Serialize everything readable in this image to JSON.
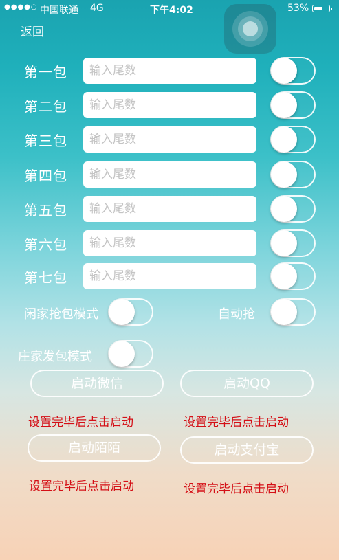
{
  "status_bar": {
    "signal": "●●●●○",
    "carrier": "中国联通",
    "network": "4G",
    "time": "下午4:02",
    "battery_percent": "53%"
  },
  "nav": {
    "back_label": "返回"
  },
  "packages": [
    {
      "label": "第一包",
      "placeholder": "输入尾数",
      "value": "",
      "enabled": false
    },
    {
      "label": "第二包",
      "placeholder": "输入尾数",
      "value": "",
      "enabled": false
    },
    {
      "label": "第三包",
      "placeholder": "输入尾数",
      "value": "",
      "enabled": false
    },
    {
      "label": "第四包",
      "placeholder": "输入尾数",
      "value": "",
      "enabled": false
    },
    {
      "label": "第五包",
      "placeholder": "输入尾数",
      "value": "",
      "enabled": false
    },
    {
      "label": "第六包",
      "placeholder": "输入尾数",
      "value": "",
      "enabled": false
    },
    {
      "label": "第七包",
      "placeholder": "输入尾数",
      "value": "",
      "enabled": false
    }
  ],
  "modes": {
    "idle_grab_label": "闲家抢包模式",
    "idle_grab_enabled": false,
    "auto_grab_label": "自动抢",
    "auto_grab_enabled": false,
    "banker_send_label": "庄家发包模式",
    "banker_send_enabled": false
  },
  "launch": {
    "wechat_label": "启动微信",
    "qq_label": "启动QQ",
    "momo_label": "启动陌陌",
    "alipay_label": "启动支付宝",
    "hint_text": "设置完毕后点击启动"
  },
  "colors": {
    "hint_red": "#d40f16",
    "text_white": "#ffffff"
  }
}
